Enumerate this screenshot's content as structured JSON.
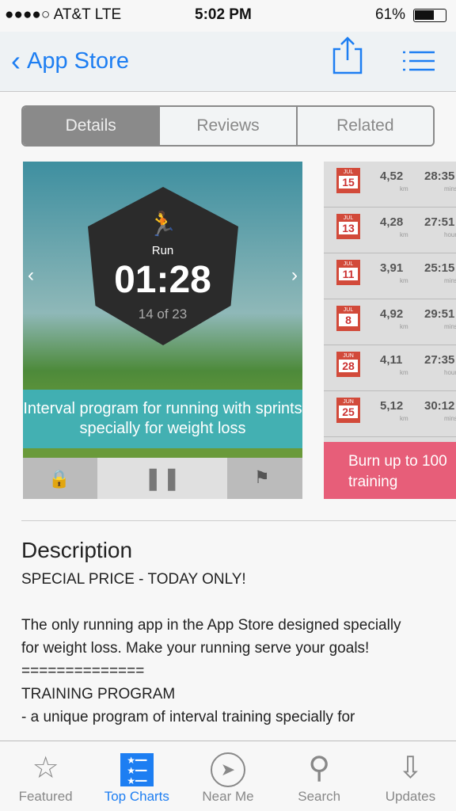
{
  "status": {
    "carrier": "●●●●○ AT&T  LTE",
    "time": "5:02 PM",
    "battery": "61%"
  },
  "nav": {
    "back": "App Store"
  },
  "segments": [
    "Details",
    "Reviews",
    "Related"
  ],
  "screenshot1": {
    "activity": "Run",
    "timer": "01:28",
    "progress": "14 of 23",
    "caption": "Interval program for running with sprints specially for weight loss"
  },
  "screenshot2": {
    "rows": [
      {
        "month": "JUL",
        "day": "15",
        "km": "4,52",
        "km_unit": "km",
        "time": "28:35",
        "time_unit": "mins"
      },
      {
        "month": "JUL",
        "day": "13",
        "km": "4,28",
        "km_unit": "km",
        "time": "27:51",
        "time_unit": "hours"
      },
      {
        "month": "JUL",
        "day": "11",
        "km": "3,91",
        "km_unit": "km",
        "time": "25:15",
        "time_unit": "mins"
      },
      {
        "month": "JUL",
        "day": "8",
        "km": "4,92",
        "km_unit": "km",
        "time": "29:51",
        "time_unit": "mins"
      },
      {
        "month": "JUN",
        "day": "28",
        "km": "4,11",
        "km_unit": "km",
        "time": "27:35",
        "time_unit": "hours"
      },
      {
        "month": "JUN",
        "day": "25",
        "km": "5,12",
        "km_unit": "km",
        "time": "30:12",
        "time_unit": "mins"
      }
    ],
    "caption": "Burn up to 100\ntraining"
  },
  "description": {
    "title": "Description",
    "lines": [
      "SPECIAL PRICE - TODAY ONLY!",
      "",
      "The only running app in the App Store designed specially for weight loss. Make your running serve your goals!",
      "==============",
      "TRAINING PROGRAM",
      "- a unique program of interval training specially for"
    ]
  },
  "tabs": [
    {
      "label": "Featured",
      "icon": "star-icon"
    },
    {
      "label": "Top Charts",
      "icon": "list-icon"
    },
    {
      "label": "Near Me",
      "icon": "location-icon"
    },
    {
      "label": "Search",
      "icon": "search-icon"
    },
    {
      "label": "Updates",
      "icon": "download-icon"
    }
  ],
  "colors": {
    "accent": "#1d7ef2"
  }
}
